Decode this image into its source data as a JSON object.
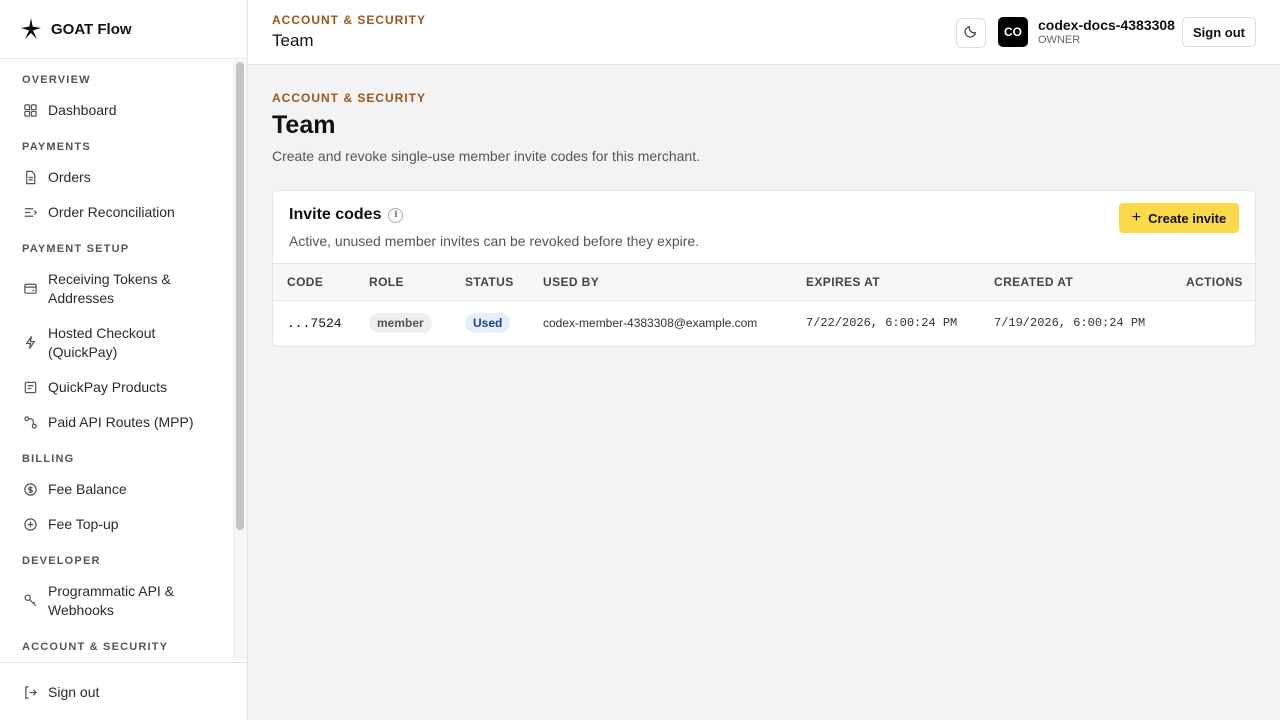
{
  "app": {
    "name": "GOAT Flow"
  },
  "sidebar": {
    "sections": [
      {
        "title": "OVERVIEW"
      },
      {
        "title": "PAYMENTS"
      },
      {
        "title": "PAYMENT SETUP"
      },
      {
        "title": "BILLING"
      },
      {
        "title": "DEVELOPER"
      },
      {
        "title": "ACCOUNT & SECURITY"
      }
    ],
    "items": [
      {
        "label": "Dashboard",
        "icon": "grid-icon"
      },
      {
        "label": "Orders",
        "icon": "document-icon"
      },
      {
        "label": "Order Reconciliation",
        "icon": "reconcile-icon"
      },
      {
        "label": "Receiving Tokens & Addresses",
        "icon": "wallet-icon"
      },
      {
        "label": "Hosted Checkout (QuickPay)",
        "icon": "lightning-icon"
      },
      {
        "label": "QuickPay Products",
        "icon": "receipt-icon"
      },
      {
        "label": "Paid API Routes (MPP)",
        "icon": "route-icon"
      },
      {
        "label": "Fee Balance",
        "icon": "coin-icon"
      },
      {
        "label": "Fee Top-up",
        "icon": "plus-circle-icon"
      },
      {
        "label": "Programmatic API & Webhooks",
        "icon": "key-icon"
      }
    ],
    "signout_label": "Sign out"
  },
  "header": {
    "eyebrow": "ACCOUNT & SECURITY",
    "title": "Team",
    "avatar_initials": "CO",
    "user_name": "codex-docs-4383308",
    "user_role": "OWNER",
    "signout_label": "Sign out"
  },
  "page": {
    "eyebrow": "ACCOUNT & SECURITY",
    "title": "Team",
    "description": "Create and revoke single-use member invite codes for this merchant."
  },
  "invites": {
    "title": "Invite codes",
    "info_glyph": "i",
    "description": "Active, unused member invites can be revoked before they expire.",
    "create_label": "Create invite",
    "columns": [
      "CODE",
      "ROLE",
      "STATUS",
      "USED BY",
      "EXPIRES AT",
      "CREATED AT",
      "ACTIONS"
    ],
    "rows": [
      {
        "code": "...7524",
        "role": "member",
        "status": "Used",
        "used_by": "codex-member-4383308@example.com",
        "expires_at": "7/22/2026, 6:00:24 PM",
        "created_at": "7/19/2026, 6:00:24 PM"
      }
    ]
  },
  "colors": {
    "accent_eyebrow": "#a0561a",
    "primary_button": "#fad94a",
    "status_used_bg": "#e6eefb",
    "status_used_text": "#1f3f8f"
  }
}
